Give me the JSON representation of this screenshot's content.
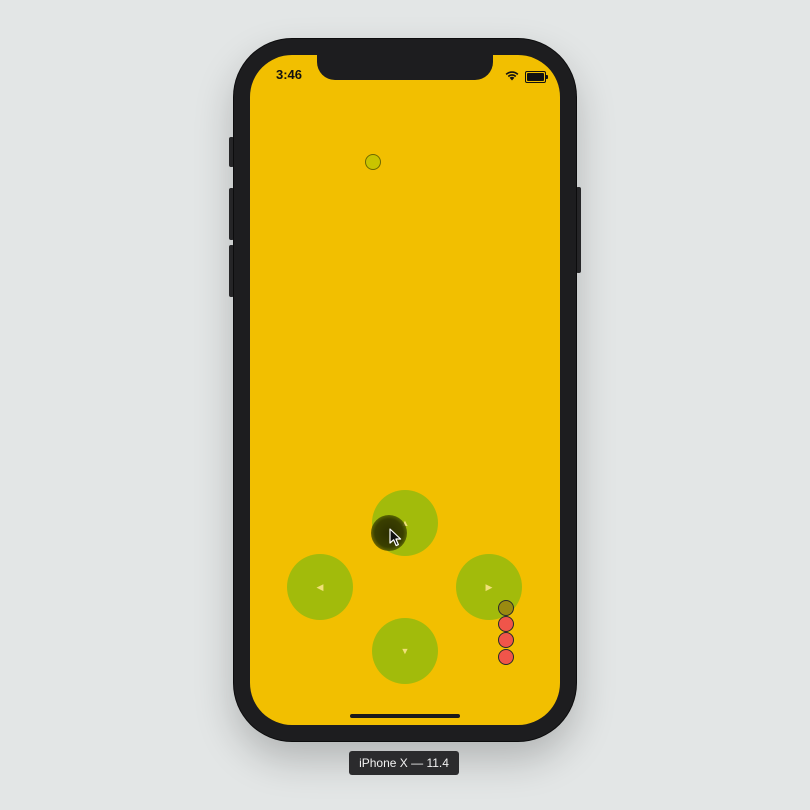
{
  "status_bar": {
    "time": "3:46",
    "icons": [
      "wifi-icon",
      "battery-icon"
    ]
  },
  "game": {
    "background_color": "#f2bf00",
    "food_color": "#c9c400",
    "snake_head_color": "#9a8a10",
    "snake_body_color": "#f0554a",
    "snake_segment_count": 4
  },
  "controls": {
    "button_color": "#a2bb0b",
    "up_icon": "caret-up-icon",
    "left_icon": "caret-left-icon",
    "right_icon": "caret-right-icon",
    "down_icon": "caret-down-icon",
    "up_glyph": "▲",
    "left_glyph": "◀",
    "right_glyph": "▶",
    "down_glyph": "▼"
  },
  "simulator": {
    "device_label": "iPhone X — 11.4"
  }
}
